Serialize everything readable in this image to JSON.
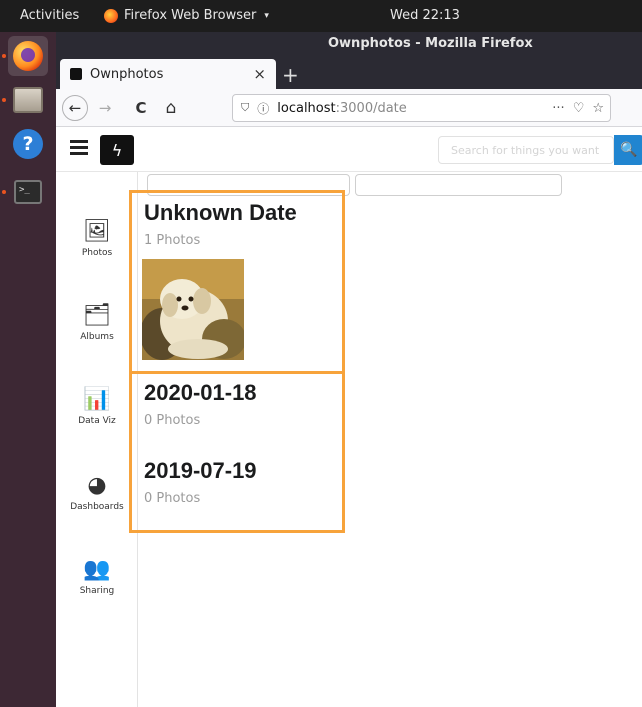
{
  "topbar": {
    "activities": "Activities",
    "app_name": "Firefox Web Browser",
    "app_caret": "▾",
    "clock": "Wed 22:13"
  },
  "dock": {
    "items": [
      {
        "name": "Firefox"
      },
      {
        "name": "Files"
      },
      {
        "name": "Help",
        "glyph": "?"
      },
      {
        "name": "Terminal",
        "glyph": ">_"
      }
    ]
  },
  "window": {
    "title": "Ownphotos - Mozilla Firefox"
  },
  "tab": {
    "title": "Ownphotos",
    "close": "×",
    "new_tab": "+"
  },
  "nav": {
    "back": "←",
    "forward": "→",
    "reload": "C",
    "home": "⌂",
    "url_host": "localhost",
    "url_path": ":3000/date",
    "shield": "⛉",
    "info": "ⓘ",
    "more": "···",
    "pocket": "♡",
    "bookmark": "☆"
  },
  "app": {
    "logo_glyph": "ϟ",
    "search_placeholder": "Search for things you want",
    "search_glyph": "🔍"
  },
  "sidebar": {
    "items": [
      {
        "label": "Photos",
        "glyph": "🖼"
      },
      {
        "label": "Albums",
        "glyph": "🗂"
      },
      {
        "label": "Data Viz",
        "glyph": "📊"
      },
      {
        "label": "Dashboards",
        "glyph": "◕"
      },
      {
        "label": "Sharing",
        "glyph": "👥"
      }
    ]
  },
  "groups": [
    {
      "date": "Unknown Date",
      "count": "1 Photos"
    },
    {
      "date": "2020-01-18",
      "count": "0 Photos"
    },
    {
      "date": "2019-07-19",
      "count": "0 Photos"
    }
  ],
  "colors": {
    "highlight": "#f7a33b",
    "search_button": "#2185d0",
    "dock": "#3d2834"
  }
}
